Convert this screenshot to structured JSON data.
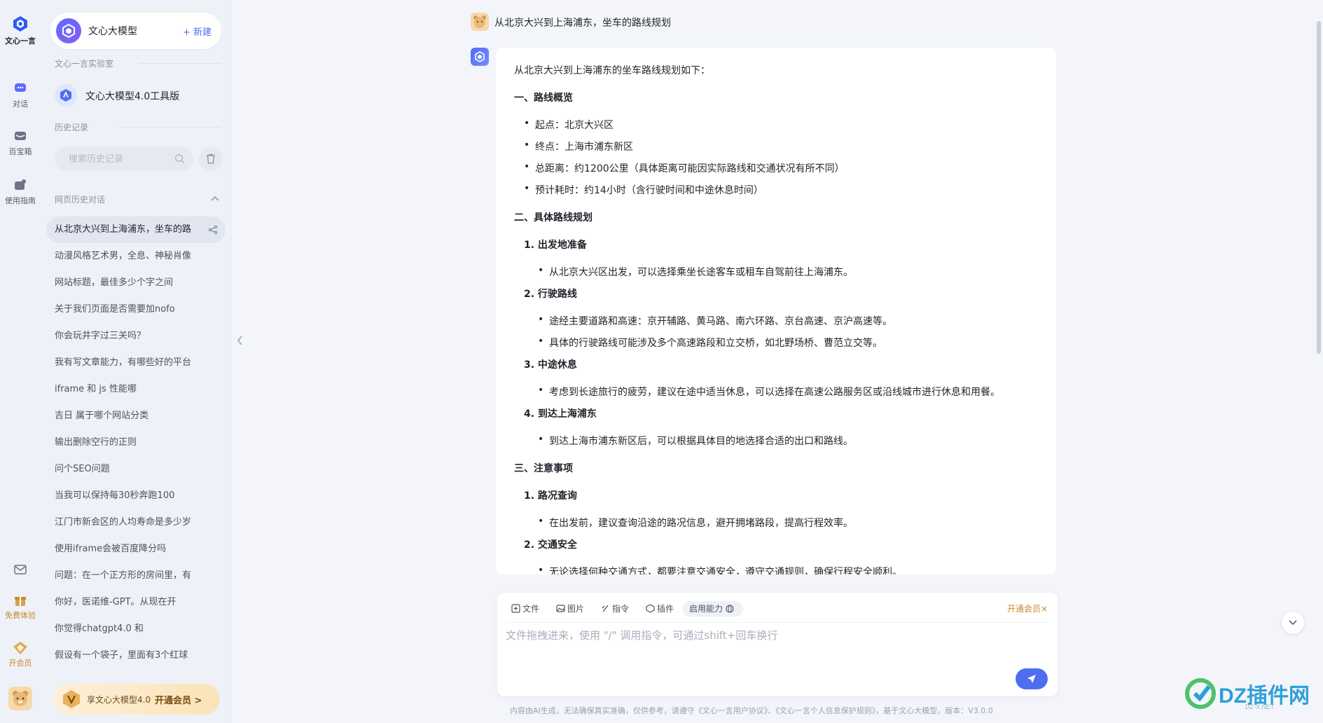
{
  "rail": {
    "logo_label": "文心一言",
    "items": [
      {
        "label": "对话",
        "icon": "chat-icon"
      },
      {
        "label": "百宝箱",
        "icon": "toolbox-icon"
      },
      {
        "label": "使用指南",
        "icon": "guide-icon"
      }
    ],
    "bottom": [
      {
        "label": "",
        "icon": "mail-icon"
      },
      {
        "label": "免费体验",
        "icon": "gift-icon"
      },
      {
        "label": "开会员",
        "icon": "vip-icon"
      }
    ]
  },
  "sidebar": {
    "model_name": "文心大模型",
    "new_label": "+ 新建",
    "lab_label": "文心一言实验室",
    "tool_label": "文心大模型4.0工具版",
    "history_label": "历史记录",
    "search_placeholder": "搜索历史记录",
    "web_history_label": "网页历史对话",
    "history_items": [
      "从北京大兴到上海浦东，坐车的路",
      "动漫风格艺术男，全息、神秘肖像",
      "网站标题，最佳多少个字之间",
      "关于我们页面是否需要加nofo",
      "你会玩井字过三关吗？",
      "我有写文章能力，有哪些好的平台",
      "iframe 和 js 性能哪",
      "吉日 属于哪个网站分类",
      "输出删除空行的正则",
      "问个SEO问题",
      "当我可以保持每30秒奔跑100",
      "江门市新会区的人均寿命是多少岁",
      "使用iframe会被百度降分吗",
      "问题：在一个正方形的房间里，有",
      "你好，医诺维-GPT。从现在开",
      "你觉得chatgpt4.0 和",
      "假设有一个袋子，里面有3个红球"
    ],
    "vip_text": "享文心大模型4.0",
    "vip_action": "开通会员 >"
  },
  "chat": {
    "question": "从北京大兴到上海浦东，坐车的路线规划",
    "answer": {
      "intro": "从北京大兴到上海浦东的坐车路线规划如下：",
      "section1_title": "一、路线概览",
      "overview": [
        "起点：北京大兴区",
        "终点：上海市浦东新区",
        "总距离：约1200公里（具体距离可能因实际路线和交通状况有所不同）",
        "预计耗时：约14小时（含行驶时间和中途休息时间）"
      ],
      "section2_title": "二、具体路线规划",
      "step1_title": "1. 出发地准备",
      "step1_items": [
        "从北京大兴区出发，可以选择乘坐长途客车或租车自驾前往上海浦东。"
      ],
      "step2_title": "2. 行驶路线",
      "step2_items": [
        "途经主要道路和高速：京开辅路、黄马路、南六环路、京台高速、京沪高速等。",
        "具体的行驶路线可能涉及多个高速路段和立交桥，如北野场桥、曹范立交等。"
      ],
      "step3_title": "3. 中途休息",
      "step3_items": [
        "考虑到长途旅行的疲劳，建议在途中适当休息，可以选择在高速公路服务区或沿线城市进行休息和用餐。"
      ],
      "step4_title": "4. 到达上海浦东",
      "step4_items": [
        "到达上海市浦东新区后，可以根据具体目的地选择合适的出口和路线。"
      ],
      "section3_title": "三、注意事项",
      "note1_title": "1. 路况查询",
      "note1_items": [
        "在出发前，建议查询沿途的路况信息，避开拥堵路段，提高行程效率。"
      ],
      "note2_title": "2. 交通安全",
      "note2_items": [
        "无论选择何种交通方式，都要注意交通安全，遵守交通规则，确保行程安全顺利。"
      ]
    }
  },
  "input": {
    "tools": [
      "文件",
      "图片",
      "指令",
      "插件",
      "启用能力"
    ],
    "vip_link": "开通会员×",
    "placeholder": "文件拖拽进来，使用 \"/\" 调用指令，可通过shift+回车换行"
  },
  "footer": "内容由AI生成，无法确保真实准确，仅供参考，请遵守《文心一言用户协议》、《文心一言个人信息保护规则》，基于文心大模型，版本：V3.0.0",
  "watermark": {
    "text": "DZ插件网",
    "sub": "DZ-X.NET"
  },
  "colors": {
    "accent": "#4e6ef2",
    "vip": "#c88a2b",
    "bg": "#f3f5fa"
  }
}
